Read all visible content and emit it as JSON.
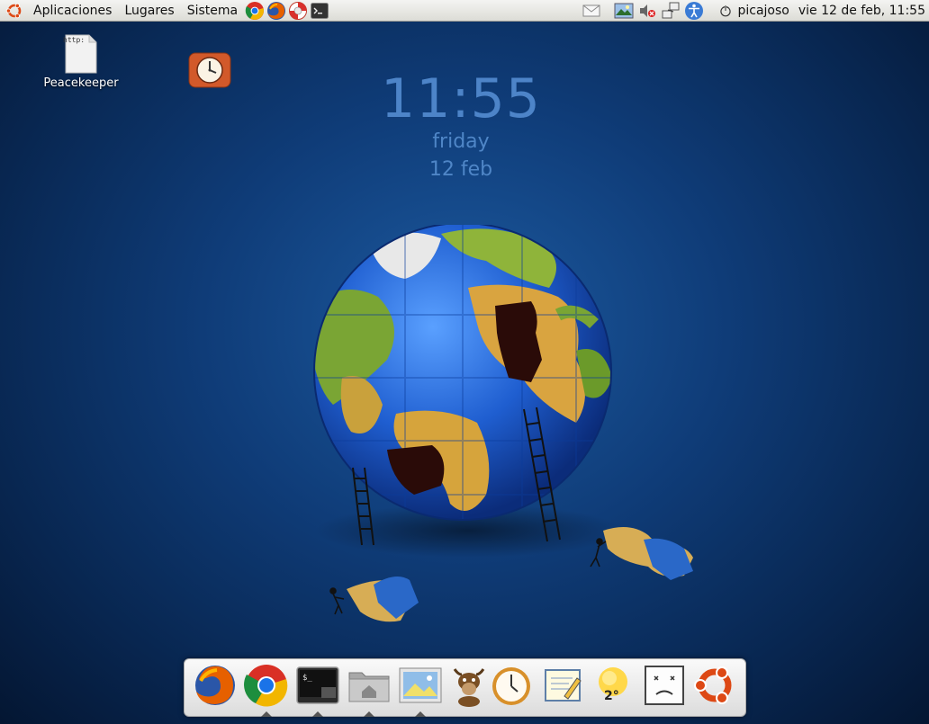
{
  "top_panel": {
    "menus": [
      "Aplicaciones",
      "Lugares",
      "Sistema"
    ],
    "user": "picajoso",
    "datetime": "vie 12 de feb, 11:55"
  },
  "desktop": {
    "file_icon_text": "http:",
    "file_label": "Peacekeeper"
  },
  "clock_widget": {
    "time": "11:55",
    "day": "friday",
    "date": "12 feb"
  },
  "dock": {
    "weather_temp": "2°"
  },
  "colors": {
    "accent": "#4d84c8",
    "ubuntu_orange": "#dd4814",
    "desktop_bg": "#0f3c78"
  }
}
